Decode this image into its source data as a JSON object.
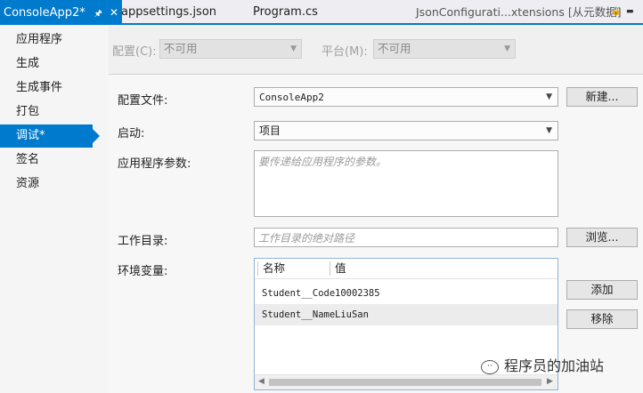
{
  "tabs": {
    "active": "ConsoleApp2*",
    "items": [
      "appsettings.json",
      "Program.cs"
    ],
    "right": "JsonConfigurati...xtensions [从元数据]"
  },
  "nav": {
    "items": [
      "应用程序",
      "生成",
      "生成事件",
      "打包",
      "调试*",
      "签名",
      "资源"
    ],
    "active_index": 4
  },
  "config": {
    "config_label": "配置(C):",
    "config_value": "不可用",
    "platform_label": "平台(M):",
    "platform_value": "不可用"
  },
  "form": {
    "profile_label": "配置文件:",
    "profile_value": "ConsoleApp2",
    "new_button": "新建...",
    "launch_label": "启动:",
    "launch_value": "项目",
    "args_label": "应用程序参数:",
    "args_placeholder": "要传递给应用程序的参数。",
    "workdir_label": "工作目录:",
    "workdir_placeholder": "工作目录的绝对路径",
    "browse_button": "浏览...",
    "env_label": "环境变量:",
    "add_button": "添加",
    "remove_button": "移除"
  },
  "env": {
    "columns": [
      "名称",
      "值"
    ],
    "rows": [
      {
        "name": "Student__Code",
        "value": "10002385"
      },
      {
        "name": "Student__Name",
        "value": "LiuSan"
      }
    ]
  },
  "watermark": "程序员的加油站"
}
